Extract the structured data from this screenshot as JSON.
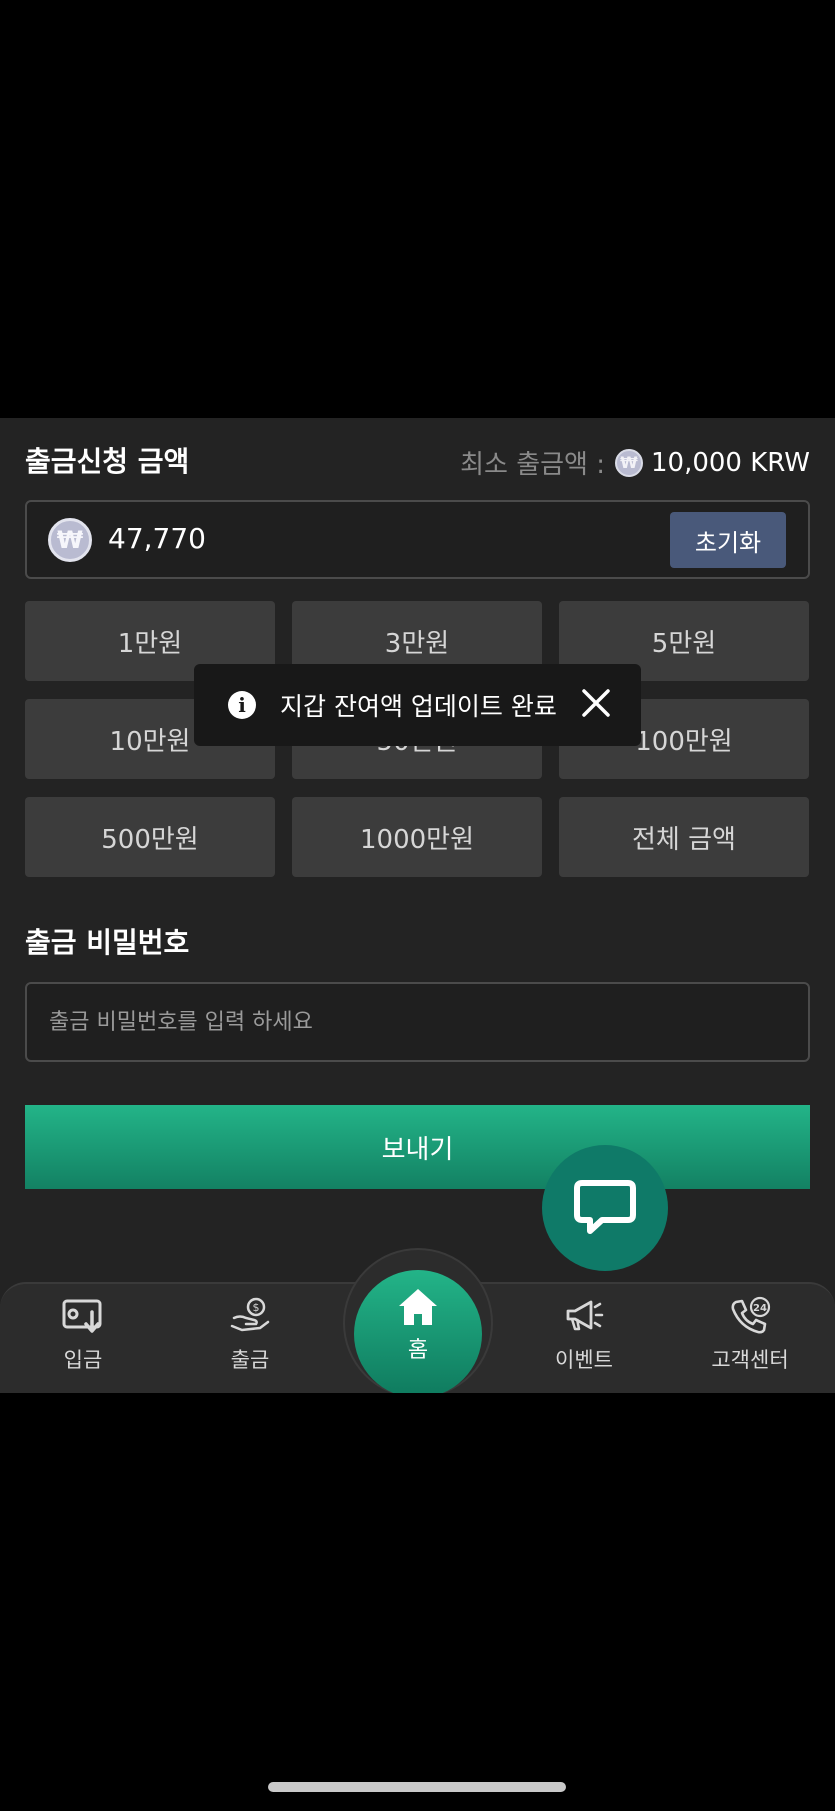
{
  "withdraw": {
    "title": "출금신청 금액",
    "min_label": "최소 출금액 :",
    "min_value": "10,000 KRW",
    "currency_symbol": "₩",
    "amount": "47,770",
    "reset_label": "초기화"
  },
  "quick_amounts": [
    "1만원",
    "3만원",
    "5만원",
    "10만원",
    "50만원",
    "100만원",
    "500만원",
    "1000만원",
    "전체 금액"
  ],
  "toast": {
    "message": "지갑 잔여액 업데이트 완료"
  },
  "password": {
    "title": "출금 비밀번호",
    "placeholder": "출금 비밀번호를 입력 하세요"
  },
  "send_label": "보내기",
  "nav": {
    "deposit": "입금",
    "withdraw": "출금",
    "home": "홈",
    "event": "이벤트",
    "support": "고객센터"
  },
  "colors": {
    "accent": "#23b488",
    "reset_button": "#49597a",
    "panel": "#232323"
  }
}
